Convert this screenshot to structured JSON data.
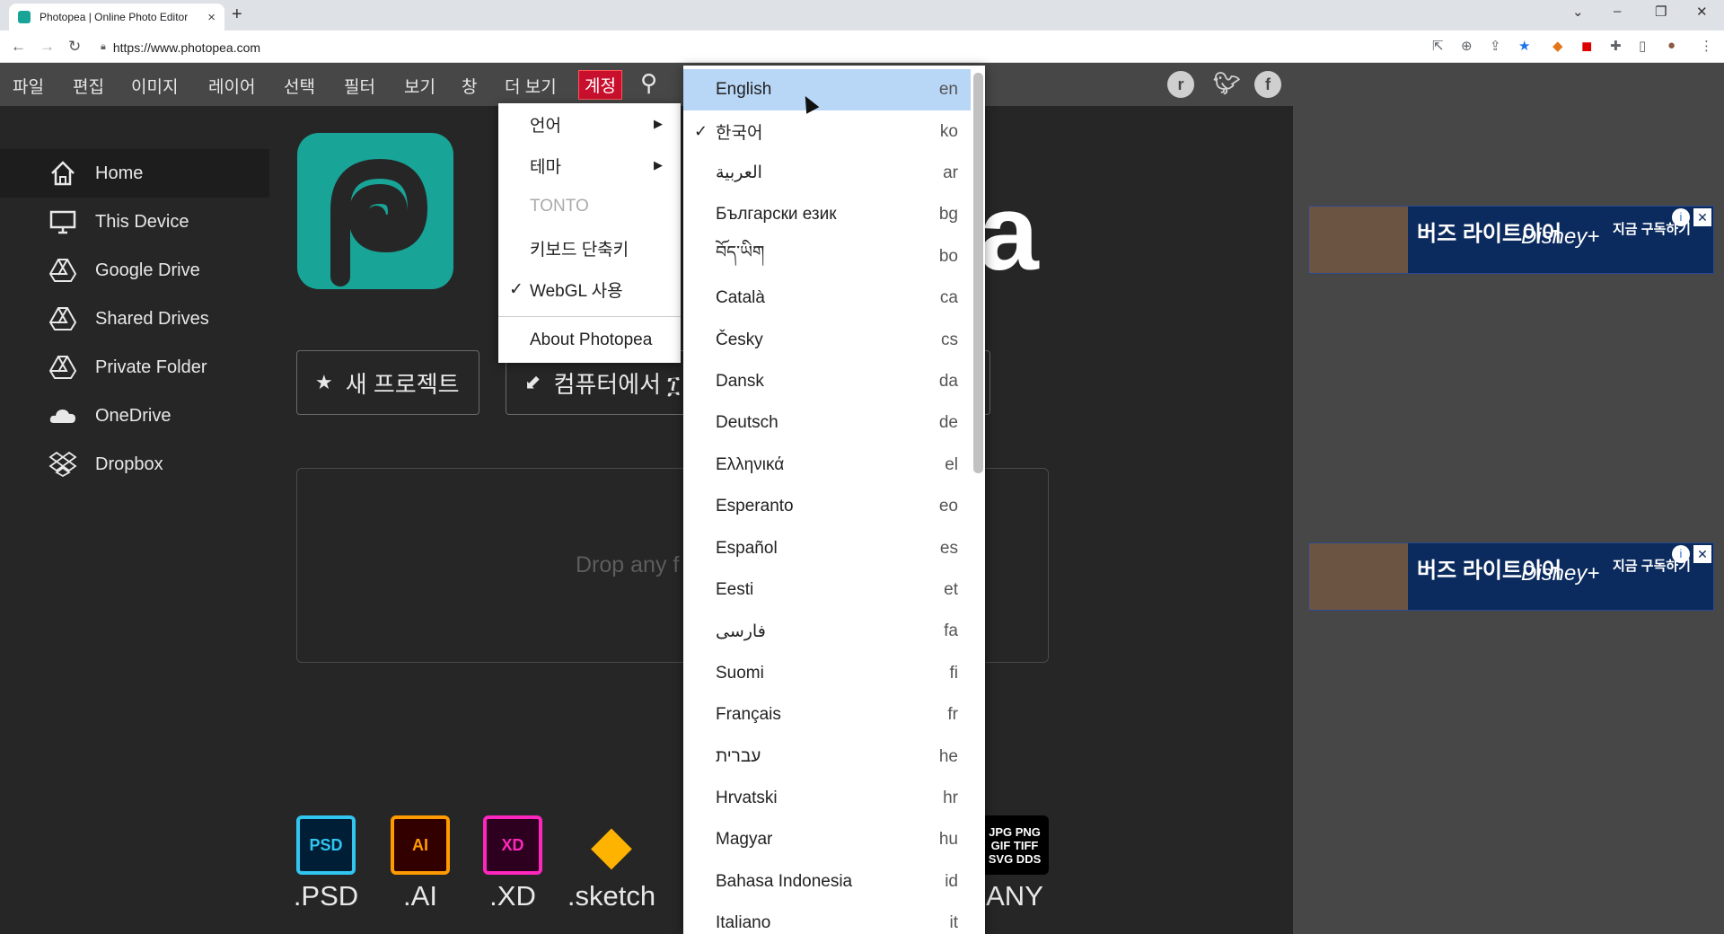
{
  "browser": {
    "tab_title": "Photopea | Online Photo Editor",
    "url": "https://www.photopea.com",
    "new_tab": "+",
    "tab_close": "×",
    "window_controls": [
      "⌄",
      "–",
      "❐",
      "✕"
    ]
  },
  "menubar": {
    "items": [
      "파일",
      "편집",
      "이미지",
      "레이어",
      "선택",
      "필터",
      "보기",
      "창",
      "더 보기",
      "계정"
    ],
    "social": [
      "reddit",
      "twitter",
      "facebook"
    ]
  },
  "sidebar": {
    "items": [
      {
        "label": "Home",
        "icon": "home-icon"
      },
      {
        "label": "This Device",
        "icon": "monitor-icon"
      },
      {
        "label": "Google Drive",
        "icon": "google-drive-icon"
      },
      {
        "label": "Shared Drives",
        "icon": "shared-drives-icon"
      },
      {
        "label": "Private Folder",
        "icon": "private-folder-icon"
      },
      {
        "label": "OneDrive",
        "icon": "onedrive-icon"
      },
      {
        "label": "Dropbox",
        "icon": "dropbox-icon"
      }
    ]
  },
  "main": {
    "logo_letter": "a",
    "new_project": "새 프로젝트",
    "open_from_computer": "컴퓨터에서 ፲",
    "drop_text": "Drop any f",
    "formats": [
      {
        "icon": "PSD",
        "ext": ".PSD",
        "color": "#31c5f0"
      },
      {
        "icon": "AI",
        "ext": ".AI",
        "color": "#ff9a00"
      },
      {
        "icon": "XD",
        "ext": ".XD",
        "color": "#ff26be"
      },
      {
        "icon": "◆",
        "ext": ".sketch",
        "color": "#fdb300"
      },
      {
        "icon": "JPG PNG GIF TIFF SVG DDS",
        "ext": "ANY",
        "color": "#000000"
      }
    ]
  },
  "ads": {
    "title": "버즈 라이트이어",
    "brand": "Disney+",
    "cta": "지금 구독하기",
    "info": "i",
    "close": "✕"
  },
  "account_menu": {
    "language": "언어",
    "theme": "테마",
    "tonto": "TONTO",
    "shortcuts": "키보드 단축키",
    "webgl": "WebGL 사용",
    "webgl_checked": "✓",
    "about": "About Photopea",
    "submenu_arrow": "▶"
  },
  "languages": [
    {
      "name": "English",
      "code": "en"
    },
    {
      "name": "한국어",
      "code": "ko",
      "checked": "✓"
    },
    {
      "name": "العربية",
      "code": "ar"
    },
    {
      "name": "Български език",
      "code": "bg"
    },
    {
      "name": "བོད་ཡིག",
      "code": "bo"
    },
    {
      "name": "Català",
      "code": "ca"
    },
    {
      "name": "Česky",
      "code": "cs"
    },
    {
      "name": "Dansk",
      "code": "da"
    },
    {
      "name": "Deutsch",
      "code": "de"
    },
    {
      "name": "Ελληνικά",
      "code": "el"
    },
    {
      "name": "Esperanto",
      "code": "eo"
    },
    {
      "name": "Español",
      "code": "es"
    },
    {
      "name": "Eesti",
      "code": "et"
    },
    {
      "name": "فارسی",
      "code": "fa"
    },
    {
      "name": "Suomi",
      "code": "fi"
    },
    {
      "name": "Français",
      "code": "fr"
    },
    {
      "name": "עברית",
      "code": "he"
    },
    {
      "name": "Hrvatski",
      "code": "hr"
    },
    {
      "name": "Magyar",
      "code": "hu"
    },
    {
      "name": "Bahasa Indonesia",
      "code": "id"
    },
    {
      "name": "Italiano",
      "code": "it"
    }
  ]
}
